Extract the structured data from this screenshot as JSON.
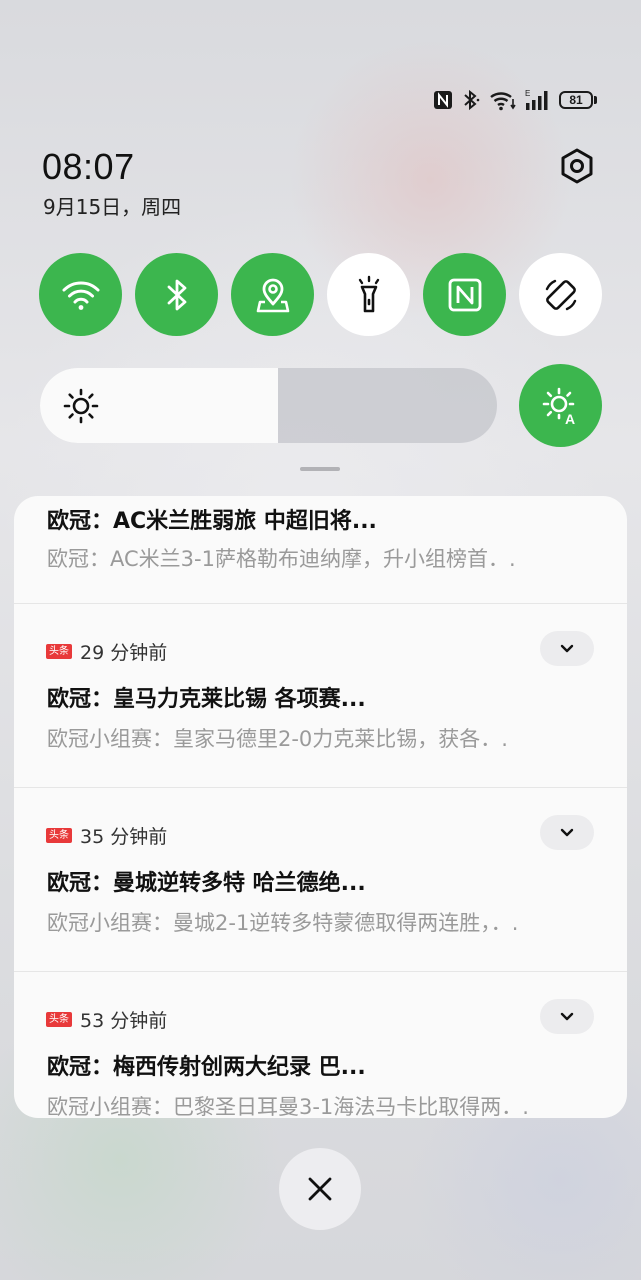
{
  "status_bar": {
    "battery_level": "81",
    "icons": [
      "nfc-icon",
      "bluetooth-icon",
      "wifi-icon",
      "cellular-signal-icon",
      "battery-icon"
    ]
  },
  "header": {
    "time": "08:07",
    "date": "9月15日，周四"
  },
  "quick_toggles": [
    {
      "icon": "wifi-icon",
      "state": "on"
    },
    {
      "icon": "bluetooth-icon",
      "state": "on"
    },
    {
      "icon": "location-icon",
      "state": "on"
    },
    {
      "icon": "flashlight-icon",
      "state": "off"
    },
    {
      "icon": "nfc-icon",
      "state": "on"
    },
    {
      "icon": "auto-rotate-icon",
      "state": "off"
    }
  ],
  "brightness": {
    "level_fraction": 0.52,
    "auto_brightness": "on"
  },
  "notifications": [
    {
      "title": "欧冠：AC米兰胜弱旅 中超旧将...",
      "body": "欧冠：AC米兰3-1萨格勒布迪纳摩，升小组榜首．."
    },
    {
      "app_badge": "头条",
      "time_ago": "29 分钟前",
      "title": "欧冠：皇马力克莱比锡 各项赛...",
      "body": "欧冠小组赛：皇家马德里2-0力克莱比锡，获各．."
    },
    {
      "app_badge": "头条",
      "time_ago": "35 分钟前",
      "title": "欧冠：曼城逆转多特 哈兰德绝...",
      "body": "欧冠小组赛：曼城2-1逆转多特蒙德取得两连胜，．."
    },
    {
      "app_badge": "头条",
      "time_ago": "53 分钟前",
      "title": "欧冠：梅西传射创两大纪录 巴...",
      "body": "欧冠小组赛：巴黎圣日耳曼3-1海法马卡比取得两．."
    }
  ],
  "colors": {
    "toggle_on": "#3cb64e",
    "toggle_off": "#ffffff",
    "app_badge": "#e8393a"
  }
}
